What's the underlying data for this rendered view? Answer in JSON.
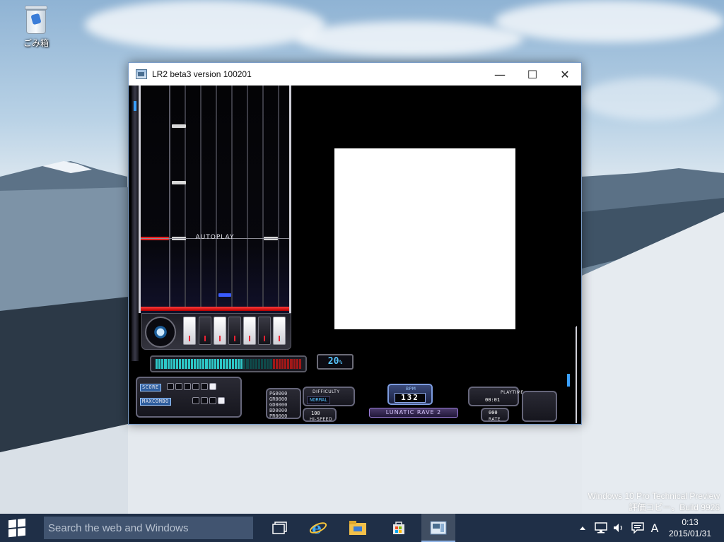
{
  "desktop": {
    "recycle_bin_label": "ごみ箱",
    "watermark_line1": "Windows 10 Pro Technical Preview",
    "watermark_line2": "評価コピー。Build 9926"
  },
  "window": {
    "title": "LR2 beta3 version 100201",
    "minimize_glyph": "—",
    "maximize_glyph": "☐",
    "close_glyph": "✕"
  },
  "game": {
    "autoplay_label": "AUTOPLAY",
    "gauge_percent": "20",
    "gauge_percent_unit": "%",
    "gauge_fraction": 0.2,
    "score_tag": "SCORE",
    "maxcombo_tag": "MAXCOMBO",
    "judge_counts": [
      "PG0000",
      "GR0000",
      "GD0000",
      "BD0000",
      "PR0000"
    ],
    "difficulty_label": "DIFFICULTY",
    "difficulty_value": "NORMAL",
    "hispeed_value": "100",
    "hispeed_label": "HI-SPEED",
    "bpm_label": "BPM",
    "bpm_value": "132",
    "logo_text": "LUNATIC RAVE 2",
    "playtime_label": "PLAYTIME",
    "playtime_value": "00:01",
    "rate_value": "000",
    "rate_label": "RATE"
  },
  "taskbar": {
    "search_placeholder": "Search the web and Windows",
    "ime_indicator": "A",
    "time": "0:13",
    "date": "2015/01/31"
  },
  "icons": {
    "start": "windows-logo-icon",
    "task_view": "task-view-icon",
    "ie": "internet-explorer-icon",
    "explorer": "file-explorer-icon",
    "store": "store-icon",
    "lr2": "lr2-app-icon"
  },
  "colors": {
    "taskbar": "#1f2f47",
    "search_box": "#415470",
    "gauge_on": "#2ec7c7",
    "gauge_off": "#0f4a4a",
    "gauge_red": "#a11818",
    "accent_blue": "#59c6ff"
  }
}
